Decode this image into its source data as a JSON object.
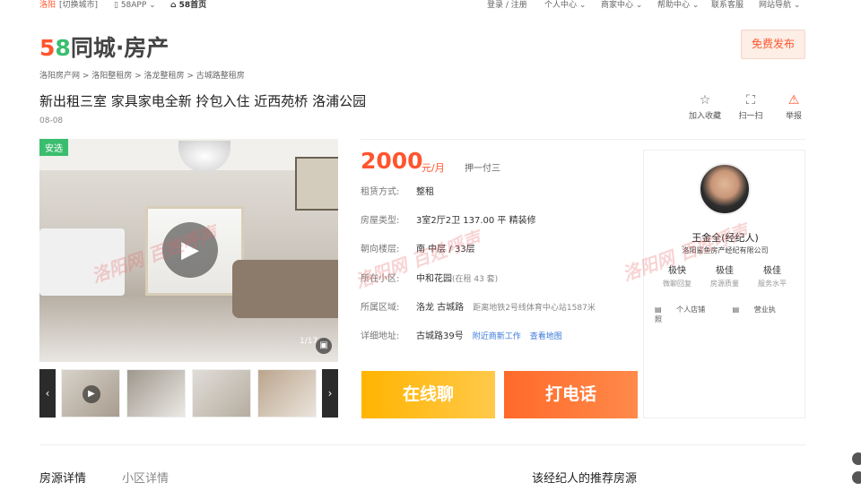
{
  "topbar": {
    "city": "洛阳",
    "switch": "[切换城市]",
    "app": "58APP",
    "home": "58首页",
    "login": "登录 / 注册",
    "personal": "个人中心",
    "merchant": "商家中心",
    "help": "帮助中心",
    "service": "联系客服",
    "nav": "网站导航"
  },
  "logo": {
    "num5": "5",
    "num8": "8",
    "text": "同城·房产"
  },
  "publish": "免费发布",
  "breadcrumb": "洛阳房产网 > 洛阳整租房 > 洛龙整租房 > 古城路整租房",
  "title": "新出租三室 家具家电全新 拎包入住 近西苑桥 洛浦公园",
  "date": "08-08",
  "tools": {
    "favorite": "加入收藏",
    "scan": "扫一扫",
    "report": "举报"
  },
  "gallery": {
    "badge": "安选",
    "counter": "1/17"
  },
  "price": {
    "value": "2000",
    "unit": "元/月",
    "pay": "押一付三"
  },
  "details": [
    {
      "key": "租赁方式:",
      "value": "整租"
    },
    {
      "key": "房屋类型:",
      "value": "3室2厅2卫  137.00 平  精装修"
    },
    {
      "key": "朝向楼层:",
      "value": "南  中层 / 33层"
    },
    {
      "key": "所在小区:",
      "value": "中和花园",
      "extra": "(在租 43 套)"
    },
    {
      "key": "所属区域:",
      "value": "洛龙  古城路",
      "extra": "距离地铁2号线体育中心站1587米"
    },
    {
      "key": "详细地址:",
      "value": "古城路39号",
      "link1": "附近商新工作",
      "link2": "查看地图"
    }
  ],
  "buttons": {
    "chat": "在线聊",
    "call": "打电话"
  },
  "agent": {
    "name": "王金全(经纪人)",
    "company": "洛阳鲨鱼房产经纪有限公司",
    "stats": [
      {
        "v": "极快",
        "k": "微聊回复"
      },
      {
        "v": "极佳",
        "k": "房源质量"
      },
      {
        "v": "极佳",
        "k": "服务水平"
      }
    ],
    "shop": "个人店铺",
    "license": "营业执照"
  },
  "watermark": "洛阳网 百姓呼声",
  "tabs": {
    "house": "房源详情",
    "community": "小区详情",
    "recommend": "该经纪人的推荐房源"
  }
}
